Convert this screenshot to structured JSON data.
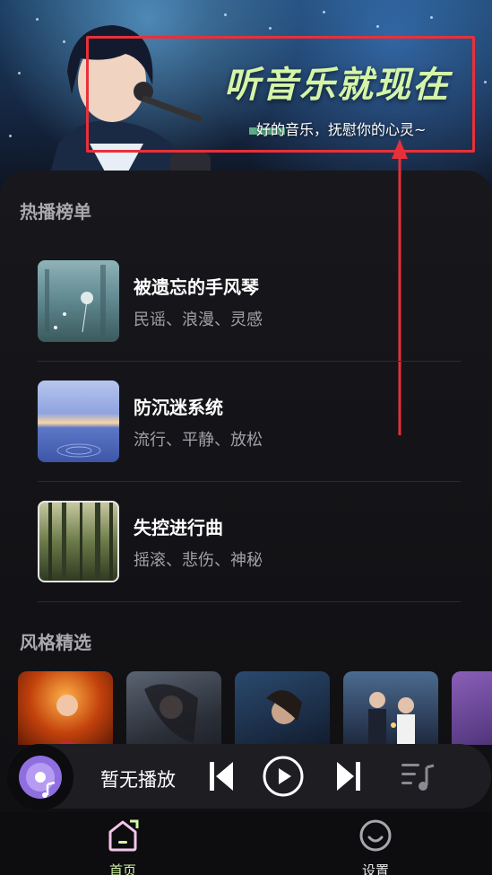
{
  "banner": {
    "title": "听音乐就现在",
    "subtitle": "好的音乐，抚慰你的心灵~"
  },
  "hot_chart": {
    "title": "热播榜单",
    "items": [
      {
        "name": "被遗忘的手风琴",
        "tags": "民谣、浪漫、灵感",
        "thumb": "dandelion-forest"
      },
      {
        "name": "防沉迷系统",
        "tags": "流行、平静、放松",
        "thumb": "calm-lake"
      },
      {
        "name": "失控进行曲",
        "tags": "摇滚、悲伤、神秘",
        "thumb": "dark-forest"
      }
    ]
  },
  "style_picks": {
    "title": "风格精选",
    "cards": [
      "singer-stage",
      "night-portrait",
      "blue-portrait",
      "couple-lights",
      "purple-glow"
    ]
  },
  "player": {
    "now_playing": "暂无播放",
    "icons": [
      "disc-icon",
      "prev-icon",
      "play-icon",
      "next-icon",
      "playlist-icon"
    ]
  },
  "tabbar": {
    "home_label": "首页",
    "settings_label": "设置"
  },
  "colors": {
    "accent_green": "#d4f5a8",
    "highlight_red": "#e8303a",
    "tab_active": "#d4f5a8"
  }
}
